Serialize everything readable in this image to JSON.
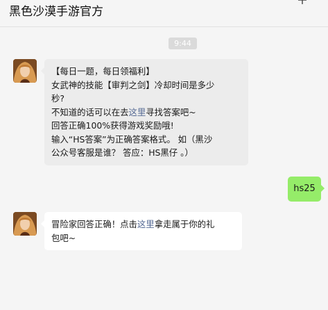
{
  "header": {
    "title": "黑色沙漠手游官方",
    "more_icon": "plus-icon"
  },
  "timestamp": "9:44",
  "messages": [
    {
      "sender": "official",
      "avatar_icon": "character-avatar",
      "lines": [
        "【每日一题，每日领福利】",
        "女武神的技能【审判之剑】冷却时间是多少",
        "秒?",
        {
          "before": "不知道的话可以在去",
          "link": "这里",
          "after": "寻找答案吧~"
        },
        "回答正确100%获得游戏奖励哦!",
        "输入“HS答案”为正确答案格式。 如（黑沙",
        "公众号客服是谁？ 答应：HS黑仔 。）"
      ]
    },
    {
      "sender": "me",
      "text": "hs25"
    },
    {
      "sender": "official",
      "avatar_icon": "character-avatar",
      "lines": [
        {
          "before": "冒险家回答正确！点击",
          "link": "这里",
          "after": "拿走属于你的礼"
        },
        "包吧~"
      ]
    }
  ],
  "colors": {
    "background": "#f5f5f5",
    "sent_bubble": "#95ec69",
    "link": "#576b95",
    "time_badge": "#dadada"
  }
}
